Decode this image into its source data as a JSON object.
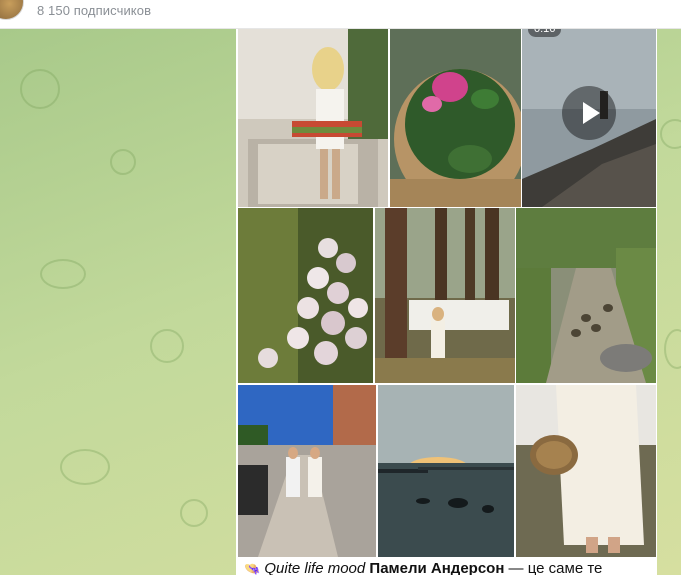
{
  "channel": {
    "subscribers": "8 150 подписчиков"
  },
  "post": {
    "video_duration": "0:16",
    "caption": {
      "emoji": "👒",
      "italic": "Quite life mood",
      "bold": "Памели Андерсон",
      "rest": " — це саме те"
    }
  },
  "icons": {
    "play": "play-icon"
  }
}
